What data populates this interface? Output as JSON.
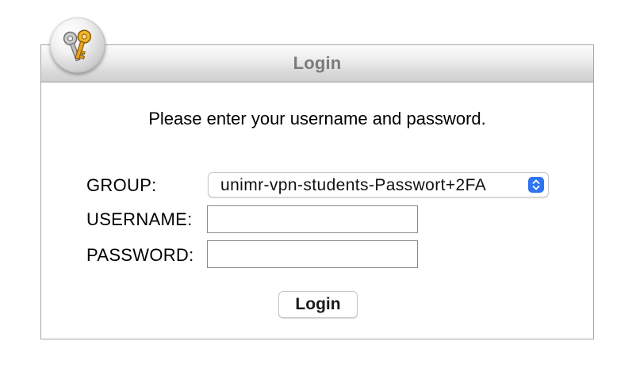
{
  "dialog": {
    "title": "Login",
    "logo_icon": "keys-icon"
  },
  "form": {
    "prompt": "Please enter your username and password.",
    "group_label": "GROUP:",
    "group_selected": "unimr-vpn-students-Passwort+2FA",
    "username_label": "USERNAME:",
    "username_value": "",
    "password_label": "PASSWORD:",
    "password_value": "",
    "submit_label": "Login"
  },
  "colors": {
    "title_text": "#7b7b7b",
    "select_accent": "#2f74f0",
    "panel_border": "#a8a8a8"
  }
}
